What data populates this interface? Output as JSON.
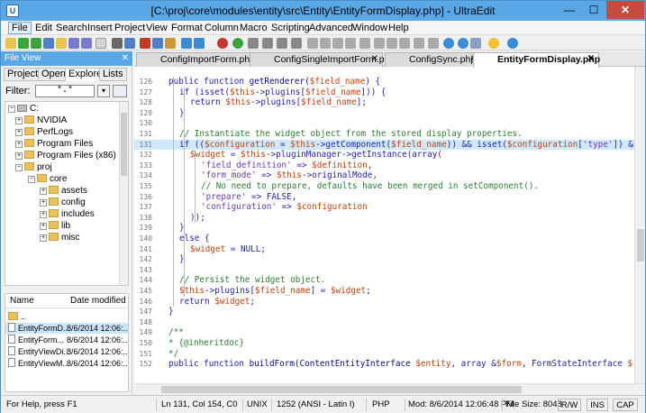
{
  "window": {
    "title": "[C:\\proj\\core\\modules\\entity\\src\\Entity\\EntityFormDisplay.php] - UltraEdit",
    "app_icon_letter": "U",
    "minimize": "—",
    "maximize": "☐",
    "close": "✕"
  },
  "menu": [
    "File",
    "Edit",
    "Search",
    "Insert",
    "Project",
    "View",
    "Format",
    "Column",
    "Macro",
    "Scripting",
    "Advanced",
    "Window",
    "Help"
  ],
  "sidebar": {
    "header": "File View",
    "close": "✕",
    "tabs": [
      "Project",
      "Open",
      "Explorer",
      "Lists"
    ],
    "filter_label": "Filter:",
    "filter_value": "*.*",
    "dropdown_arrow": "▾",
    "tree": [
      {
        "label": "C:",
        "expander": "−",
        "type": "drive"
      },
      {
        "label": "NVIDIA",
        "expander": "+",
        "type": "folder"
      },
      {
        "label": "PerfLogs",
        "expander": "+",
        "type": "folder"
      },
      {
        "label": "Program Files",
        "expander": "+",
        "type": "folder"
      },
      {
        "label": "Program Files (x86)",
        "expander": "+",
        "type": "folder"
      },
      {
        "label": "proj",
        "expander": "−",
        "type": "folder"
      },
      {
        "label": "core",
        "expander": "−",
        "type": "folder"
      },
      {
        "label": "assets",
        "expander": "+",
        "type": "folder"
      },
      {
        "label": "config",
        "expander": "+",
        "type": "folder"
      },
      {
        "label": "includes",
        "expander": "+",
        "type": "folder"
      },
      {
        "label": "lib",
        "expander": "+",
        "type": "folder"
      },
      {
        "label": "misc",
        "expander": "+",
        "type": "folder"
      }
    ],
    "list_headers": {
      "name": "Name",
      "date": "Date modified"
    },
    "files": [
      {
        "name": "..",
        "date": ""
      },
      {
        "name": "EntityFormD...",
        "date": "8/6/2014 12:06:..."
      },
      {
        "name": "EntityForm...",
        "date": "8/6/2014 12:06:..."
      },
      {
        "name": "EntityViewDi...",
        "date": "8/6/2014 12:06:..."
      },
      {
        "name": "EntityViewM...",
        "date": "8/6/2014 12:06:..."
      }
    ]
  },
  "editor": {
    "tabs": [
      {
        "label": "ConfigImportForm.php",
        "close": "✕"
      },
      {
        "label": "ConfigSingleImportForm.php",
        "close": "✕"
      },
      {
        "label": "ConfigSync.php",
        "close": "✕"
      },
      {
        "label": "EntityFormDisplay.php",
        "close": "✕"
      }
    ],
    "lines": [
      {
        "n": "126",
        "parts": [
          [
            "kw",
            "public function "
          ],
          [
            "fn",
            "getRenderer("
          ],
          [
            "var",
            "$field_name"
          ],
          [
            "plain",
            ") {"
          ]
        ],
        "indent": 1
      },
      {
        "n": "127",
        "parts": [
          [
            "kw",
            "if "
          ],
          [
            "plain",
            "(isset("
          ],
          [
            "var",
            "$this"
          ],
          [
            "plain",
            "->plugins["
          ],
          [
            "var",
            "$field_name"
          ],
          [
            "plain",
            "])) {"
          ]
        ],
        "indent": 2
      },
      {
        "n": "128",
        "parts": [
          [
            "kw",
            "return "
          ],
          [
            "var",
            "$this"
          ],
          [
            "plain",
            "->plugins["
          ],
          [
            "var",
            "$field_name"
          ],
          [
            "plain",
            "];"
          ]
        ],
        "indent": 3
      },
      {
        "n": "129",
        "parts": [
          [
            "plain",
            "}"
          ]
        ],
        "indent": 2
      },
      {
        "n": "130",
        "parts": [],
        "indent": 0
      },
      {
        "n": "131",
        "parts": [
          [
            "cm",
            "// Instantiate the widget object from the stored display properties."
          ]
        ],
        "indent": 2
      },
      {
        "n": "131",
        "parts": [
          [
            "kw",
            "if "
          ],
          [
            "plain",
            "(("
          ],
          [
            "var",
            "$configuration"
          ],
          [
            "plain",
            " = "
          ],
          [
            "var",
            "$this"
          ],
          [
            "plain",
            "->getComponent("
          ],
          [
            "var",
            "$field_name"
          ],
          [
            "plain",
            ")) && isset("
          ],
          [
            "var",
            "$configuration"
          ],
          [
            "plain",
            "["
          ],
          [
            "str",
            "'type'"
          ],
          [
            "plain",
            "]) &"
          ]
        ],
        "indent": 2,
        "hl": true
      },
      {
        "n": "132",
        "parts": [
          [
            "var",
            "$widget"
          ],
          [
            "plain",
            " = "
          ],
          [
            "var",
            "$this"
          ],
          [
            "plain",
            "->pluginManager->getInstance(array("
          ]
        ],
        "indent": 3
      },
      {
        "n": "133",
        "parts": [
          [
            "str",
            "'field_definition'"
          ],
          [
            "plain",
            " => "
          ],
          [
            "var",
            "$definition"
          ],
          [
            "plain",
            ","
          ]
        ],
        "indent": 4
      },
      {
        "n": "134",
        "parts": [
          [
            "str",
            "'form_mode'"
          ],
          [
            "plain",
            " => "
          ],
          [
            "var",
            "$this"
          ],
          [
            "plain",
            "->originalMode,"
          ]
        ],
        "indent": 4
      },
      {
        "n": "135",
        "parts": [
          [
            "cm",
            "// No need to prepare, defaults have been merged in setComponent()."
          ]
        ],
        "indent": 4
      },
      {
        "n": "136",
        "parts": [
          [
            "str",
            "'prepare'"
          ],
          [
            "plain",
            " => FALSE,"
          ]
        ],
        "indent": 4
      },
      {
        "n": "137",
        "parts": [
          [
            "str",
            "'configuration'"
          ],
          [
            "plain",
            " => "
          ],
          [
            "var",
            "$configuration"
          ]
        ],
        "indent": 4
      },
      {
        "n": "138",
        "parts": [
          [
            "plain",
            "));"
          ]
        ],
        "indent": 3
      },
      {
        "n": "139",
        "parts": [
          [
            "plain",
            "}"
          ]
        ],
        "indent": 2
      },
      {
        "n": "140",
        "parts": [
          [
            "kw",
            "else "
          ],
          [
            "plain",
            "{"
          ]
        ],
        "indent": 2
      },
      {
        "n": "141",
        "parts": [
          [
            "var",
            "$widget"
          ],
          [
            "plain",
            " = NULL;"
          ]
        ],
        "indent": 3
      },
      {
        "n": "142",
        "parts": [
          [
            "plain",
            "}"
          ]
        ],
        "indent": 2
      },
      {
        "n": "143",
        "parts": [],
        "indent": 0
      },
      {
        "n": "144",
        "parts": [
          [
            "cm",
            "// Persist the widget object."
          ]
        ],
        "indent": 2
      },
      {
        "n": "145",
        "parts": [
          [
            "var",
            "$this"
          ],
          [
            "plain",
            "->plugins["
          ],
          [
            "var",
            "$field_name"
          ],
          [
            "plain",
            "] = "
          ],
          [
            "var",
            "$widget"
          ],
          [
            "plain",
            ";"
          ]
        ],
        "indent": 2
      },
      {
        "n": "146",
        "parts": [
          [
            "kw",
            "return "
          ],
          [
            "var",
            "$widget"
          ],
          [
            "plain",
            ";"
          ]
        ],
        "indent": 2
      },
      {
        "n": "147",
        "parts": [
          [
            "plain",
            "}"
          ]
        ],
        "indent": 1
      },
      {
        "n": "148",
        "parts": [],
        "indent": 0
      },
      {
        "n": "149",
        "parts": [
          [
            "cm",
            "/**"
          ]
        ],
        "indent": 1
      },
      {
        "n": "150",
        "parts": [
          [
            "cm",
            "* {@inheritdoc}"
          ]
        ],
        "indent": 1
      },
      {
        "n": "151",
        "parts": [
          [
            "cm",
            "*/"
          ]
        ],
        "indent": 1
      },
      {
        "n": "152",
        "parts": [
          [
            "kw",
            "public function "
          ],
          [
            "fn",
            "buildForm(ContentEntityInterface "
          ],
          [
            "var",
            "$entity"
          ],
          [
            "plain",
            ", array &"
          ],
          [
            "var",
            "$form"
          ],
          [
            "plain",
            ", FormStateInterface "
          ],
          [
            "var",
            "$"
          ]
        ],
        "indent": 1
      }
    ]
  },
  "status": {
    "help": "For Help, press F1",
    "position": "Ln 131, Col 154, C0",
    "lineend": "UNIX",
    "encoding": "1252  (ANSI - Latin I)",
    "syntax": "PHP",
    "modified": "Mod: 8/6/2014 12:06:48 PM",
    "filesize": "File Size: 8048",
    "rw": "R/W",
    "ins": "INS",
    "cap": "CAP"
  },
  "colors": {
    "titlebar": "#5aa7e6",
    "keyword": "#1f1fb4",
    "variable": "#c2410c",
    "string": "#6b3ab0",
    "comment": "#2e7d32",
    "highlight": "#cfe8fb"
  }
}
